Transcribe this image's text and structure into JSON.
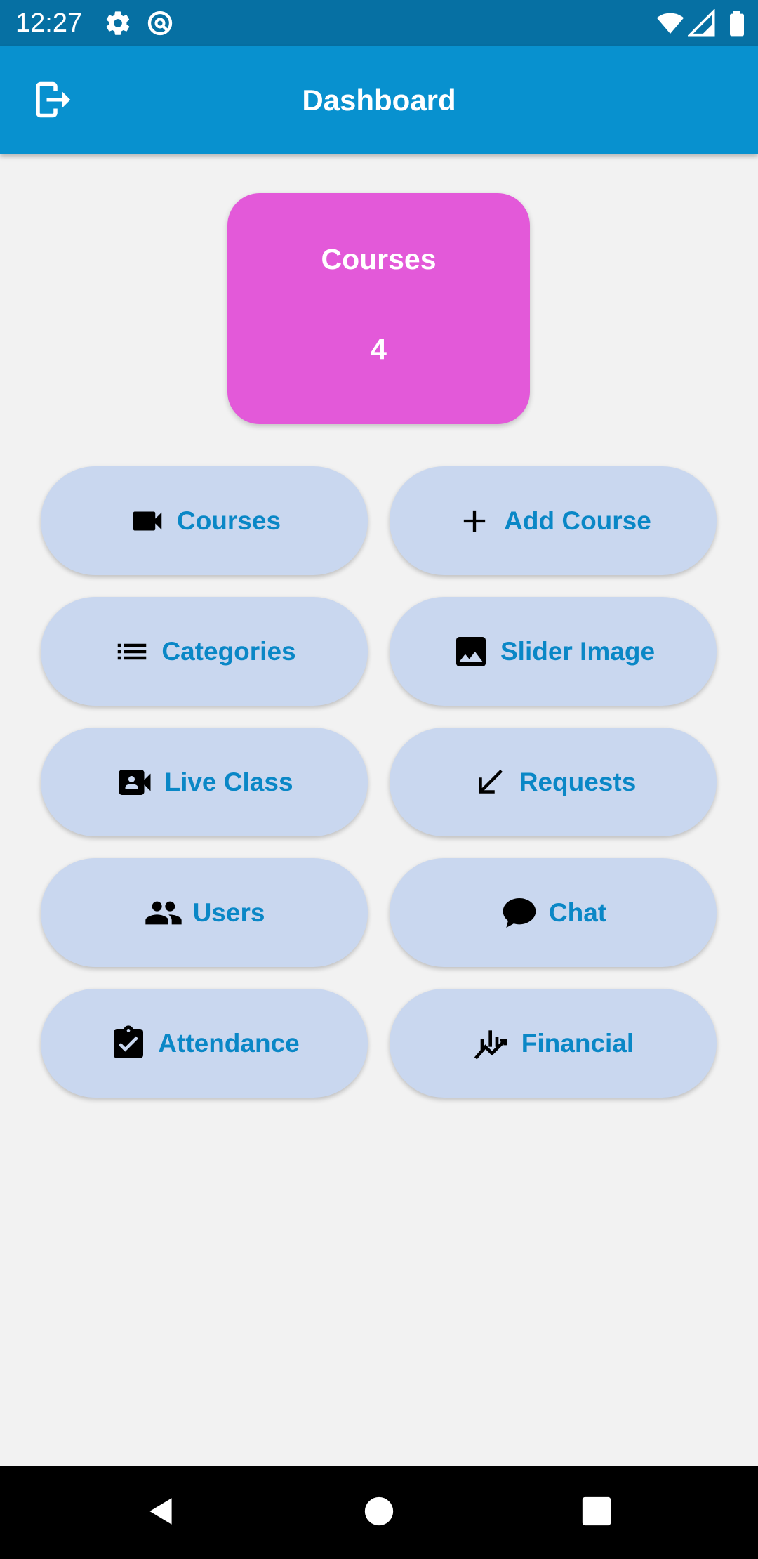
{
  "status_bar": {
    "time": "12:27",
    "icons": [
      "gear-icon",
      "at-sign-icon",
      "wifi-icon",
      "signal-icon",
      "battery-icon"
    ]
  },
  "app_bar": {
    "title": "Dashboard",
    "logout_icon": "logout-icon"
  },
  "summary": {
    "title": "Courses",
    "count": "4",
    "color": "#e359d9"
  },
  "grid": {
    "items": [
      {
        "label": "Courses",
        "icon": "videocam-icon"
      },
      {
        "label": "Add Course",
        "icon": "plus-icon"
      },
      {
        "label": "Categories",
        "icon": "list-icon"
      },
      {
        "label": "Slider Image",
        "icon": "image-icon"
      },
      {
        "label": "Live Class",
        "icon": "video-call-icon"
      },
      {
        "label": "Requests",
        "icon": "arrow-down-left-icon"
      },
      {
        "label": "Users",
        "icon": "group-icon"
      },
      {
        "label": "Chat",
        "icon": "chat-bubble-icon"
      },
      {
        "label": "Attendance",
        "icon": "clipboard-check-icon"
      },
      {
        "label": "Financial",
        "icon": "chart-icon"
      }
    ]
  },
  "nav_bar": {
    "icons": [
      "back-icon",
      "home-icon",
      "recents-icon"
    ]
  },
  "colors": {
    "status_bar": "#0670a3",
    "app_bar": "#0891cf",
    "button_bg": "#c9d7ef",
    "button_text": "#0a87c6",
    "background": "#f2f2f2"
  }
}
